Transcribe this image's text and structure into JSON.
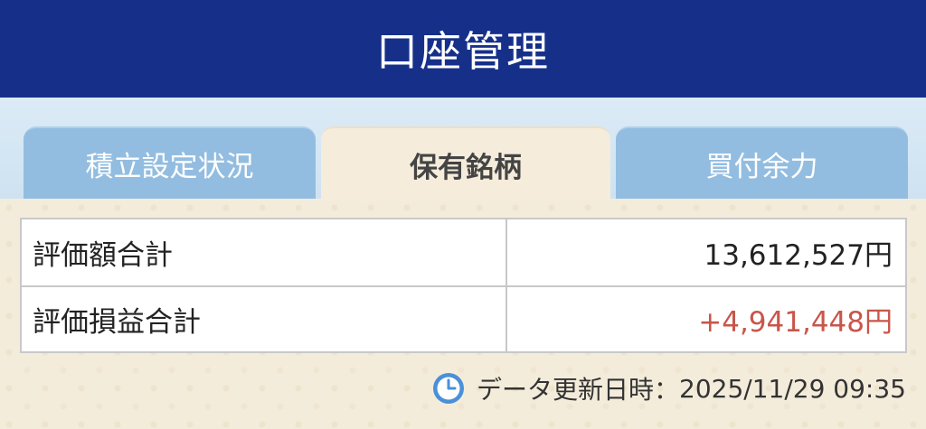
{
  "header": {
    "title": "口座管理"
  },
  "tabs": [
    {
      "label": "積立設定状況",
      "active": false
    },
    {
      "label": "保有銘柄",
      "active": true
    },
    {
      "label": "買付余力",
      "active": false
    }
  ],
  "summary": {
    "rows": [
      {
        "label": "評価額合計",
        "value": "13,612,527円"
      },
      {
        "label": "評価損益合計",
        "value": "+4,941,448円"
      }
    ]
  },
  "update": {
    "icon": "clock-icon",
    "label": "データ更新日時：",
    "datetime": "2025/11/29 09:35"
  },
  "colors": {
    "header_bg": "#16308a",
    "tab_inactive": "#93bde0",
    "tab_active": "#f5ecdb",
    "gain": "#c9554a",
    "clock_accent": "#4a90d9"
  }
}
